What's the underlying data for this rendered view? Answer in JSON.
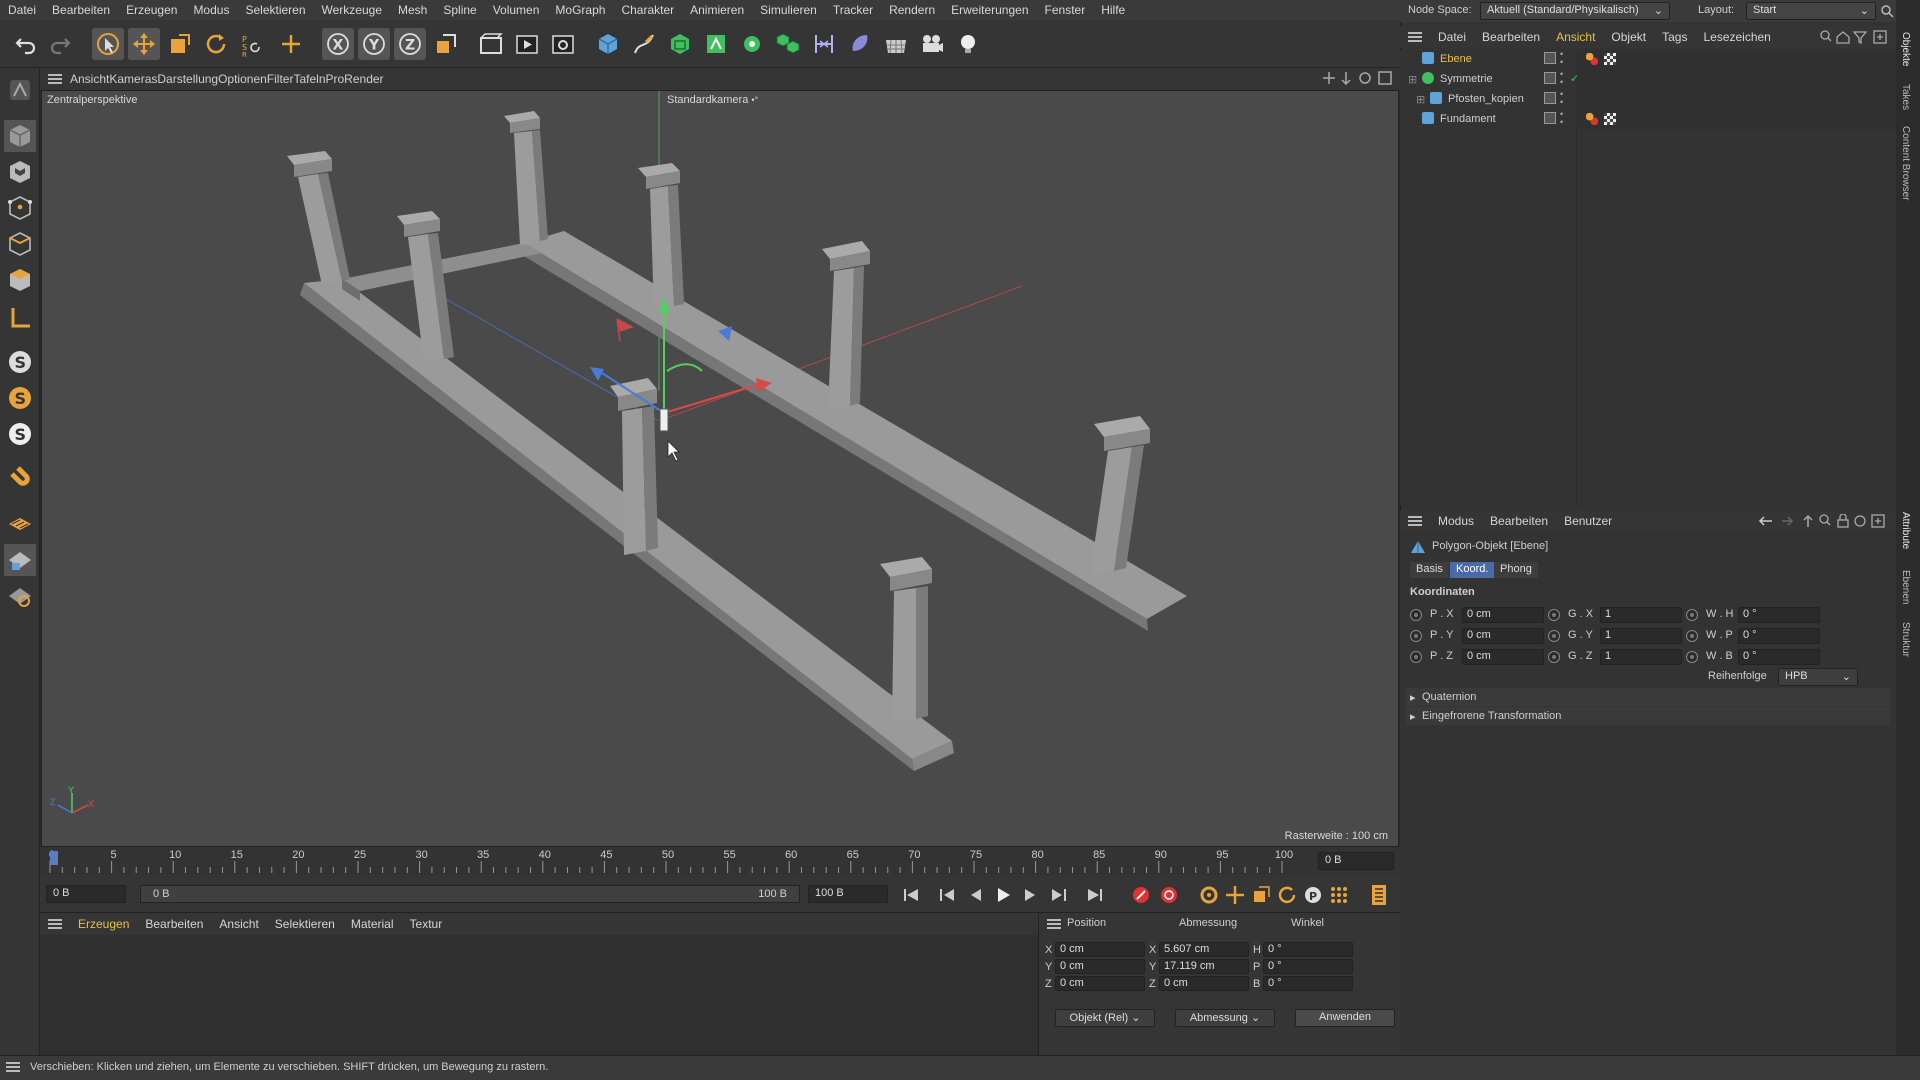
{
  "menubar": [
    "Datei",
    "Bearbeiten",
    "Erzeugen",
    "Modus",
    "Selektieren",
    "Werkzeuge",
    "Mesh",
    "Spline",
    "Volumen",
    "MoGraph",
    "Charakter",
    "Animieren",
    "Simulieren",
    "Tracker",
    "Rendern",
    "Erweiterungen",
    "Fenster",
    "Hilfe"
  ],
  "nodespace": {
    "label": "Node Space:",
    "value": "Aktuell (Standard/Physikalisch)",
    "layout_label": "Layout:",
    "layout_value": "Start"
  },
  "viewport_menu": [
    "Ansicht",
    "Kameras",
    "Darstellung",
    "Optionen",
    "Filter",
    "Tafeln",
    "ProRender"
  ],
  "viewport": {
    "perspective": "Zentralperspektive",
    "camera": "Standardkamera",
    "grid": "Rasterweite : 100 cm",
    "axis_y": "Y",
    "axis_z": "Z",
    "axis_x": "X"
  },
  "timeline": {
    "ticks": [
      "0",
      "5",
      "10",
      "15",
      "20",
      "25",
      "30",
      "35",
      "40",
      "45",
      "50",
      "55",
      "60",
      "65",
      "70",
      "75",
      "80",
      "85",
      "90",
      "95",
      "100"
    ],
    "current_frame": "0 B",
    "start": "0 B",
    "range_start": "0 B",
    "range_end": "100 B",
    "end": "100 B"
  },
  "material_menu": [
    "Erzeugen",
    "Bearbeiten",
    "Ansicht",
    "Selektieren",
    "Material",
    "Textur"
  ],
  "coords": {
    "headers": [
      "Position",
      "Abmessung",
      "Winkel"
    ],
    "rows": [
      {
        "axis": "X",
        "pos": "0 cm",
        "size_axis": "X",
        "size": "5.607 cm",
        "ang_axis": "H",
        "ang": "0 °"
      },
      {
        "axis": "Y",
        "pos": "0 cm",
        "size_axis": "Y",
        "size": "17.119 cm",
        "ang_axis": "P",
        "ang": "0 °"
      },
      {
        "axis": "Z",
        "pos": "0 cm",
        "size_axis": "Z",
        "size": "0 cm",
        "ang_axis": "B",
        "ang": "0 °"
      }
    ],
    "mode1": "Objekt (Rel)",
    "mode2": "Abmessung",
    "apply": "Anwenden"
  },
  "status": "Verschieben: Klicken und ziehen, um Elemente zu verschieben. SHIFT drücken, um Bewegung zu rastern.",
  "object_menu": [
    "Datei",
    "Bearbeiten",
    "Ansicht",
    "Objekt",
    "Tags",
    "Lesezeichen"
  ],
  "objects": [
    {
      "name": "Ebene",
      "selected": true
    },
    {
      "name": "Symmetrie",
      "selected": false
    },
    {
      "name": "Pfosten_kopien",
      "selected": false
    },
    {
      "name": "Fundament",
      "selected": false
    }
  ],
  "attr_menu": [
    "Modus",
    "Bearbeiten",
    "Benutzer"
  ],
  "attr": {
    "title": "Polygon-Objekt [Ebene]",
    "tabs": [
      "Basis",
      "Koord.",
      "Phong"
    ],
    "section": "Koordinaten",
    "rows": [
      {
        "p_label": "P . X",
        "p_val": "0 cm",
        "g_label": "G . X",
        "g_val": "1",
        "w_label": "W . H",
        "w_val": "0 °"
      },
      {
        "p_label": "P . Y",
        "p_val": "0 cm",
        "g_label": "G . Y",
        "g_val": "1",
        "w_label": "W . P",
        "w_val": "0 °"
      },
      {
        "p_label": "P . Z",
        "p_val": "0 cm",
        "g_label": "G . Z",
        "g_val": "1",
        "w_label": "W . B",
        "w_val": "0 °"
      }
    ],
    "order_label": "Reihenfolge",
    "order_val": "HPB",
    "sub1": "Quaternion",
    "sub2": "Eingefrorene Transformation"
  },
  "side_tabs": [
    "Objekte",
    "Takes",
    "Content Browser",
    "Attribute",
    "Ebenen",
    "Struktur"
  ]
}
